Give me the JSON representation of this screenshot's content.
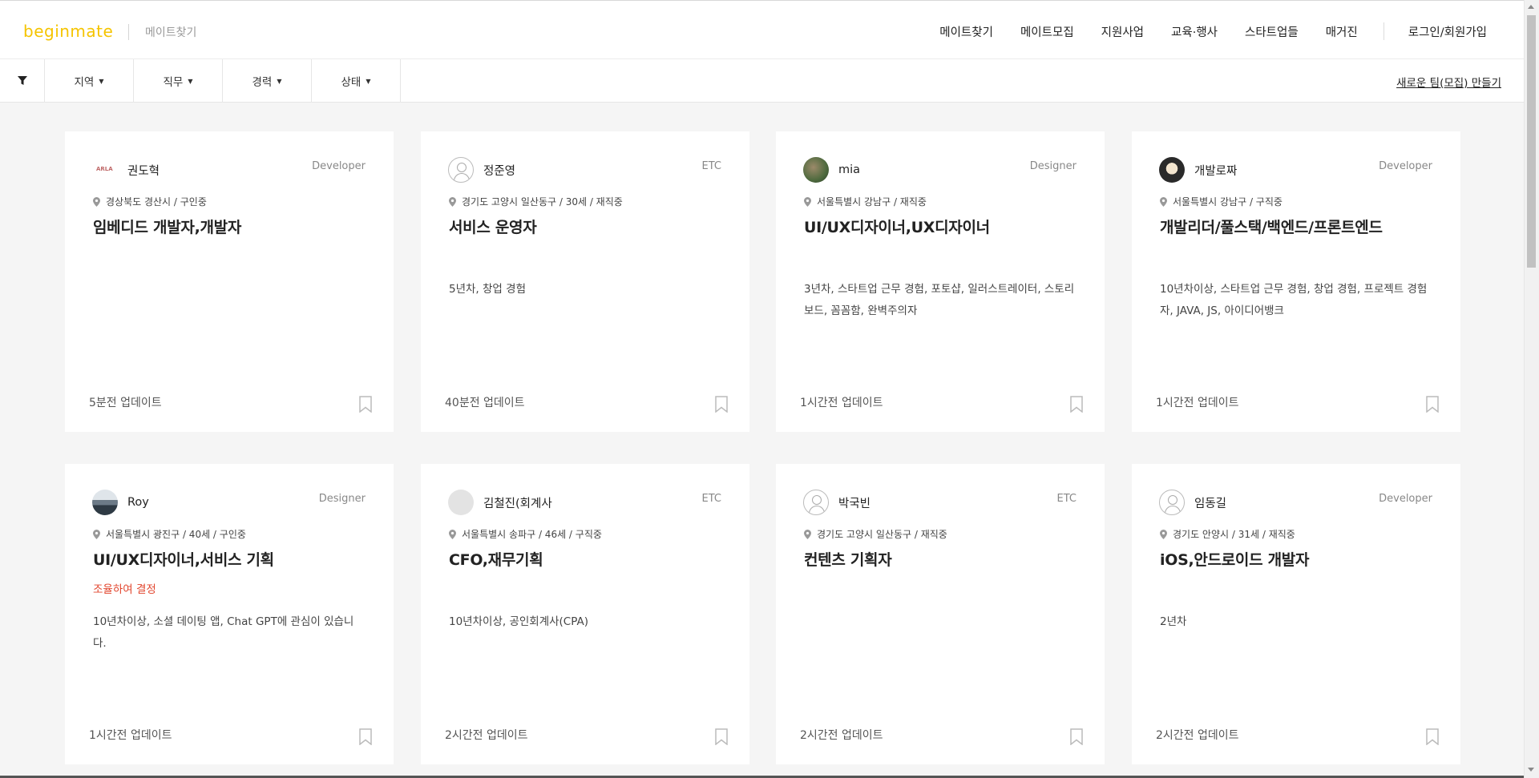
{
  "header": {
    "logo": "beginmate",
    "section": "메이트찾기",
    "nav": [
      "메이트찾기",
      "메이트모집",
      "지원사업",
      "교육·행사",
      "스타트업들",
      "매거진"
    ],
    "login": "로그인/회원가입"
  },
  "filters": {
    "icon": "filter-icon",
    "items": [
      "지역",
      "직무",
      "경력",
      "상태"
    ],
    "new_team": "새로운 팀(모집) 만들기"
  },
  "cards": [
    {
      "name": "권도혁",
      "role": "Developer",
      "avatar": "logo-tiny",
      "location": "경상북도 경산시 / 구인중",
      "title": "임베디드 개발자,개발자",
      "note": "",
      "desc": "",
      "updated": "5분전 업데이트"
    },
    {
      "name": "정준영",
      "role": "ETC",
      "avatar": "default",
      "location": "경기도 고양시 일산동구 / 30세 / 재직중",
      "title": "서비스 운영자",
      "note": "",
      "desc": "5년차, 창업 경험",
      "updated": "40분전 업데이트"
    },
    {
      "name": "mia",
      "role": "Designer",
      "avatar": "photo1",
      "location": "서울특별시 강남구 / 재직중",
      "title": "UI/UX디자이너,UX디자이너",
      "note": "",
      "desc": "3년차, 스타트업 근무 경험, 포토샵, 일러스트레이터, 스토리보드, 꼼꼼함, 완벽주의자",
      "updated": "1시간전 업데이트"
    },
    {
      "name": "개발로짜",
      "role": "Developer",
      "avatar": "photo2",
      "location": "서울특별시 강남구 / 구직중",
      "title": "개발리더/풀스택/백엔드/프론트엔드",
      "note": "",
      "desc": "10년차이상, 스타트업 근무 경험, 창업 경험, 프로젝트 경험자, JAVA, JS, 아이디어뱅크",
      "updated": "1시간전 업데이트"
    },
    {
      "name": "Roy",
      "role": "Designer",
      "avatar": "photo3",
      "location": "서울특별시 광진구 / 40세 / 구인중",
      "title": "UI/UX디자이너,서비스 기획",
      "note": "조율하여 결정",
      "desc": "10년차이상, 소셜 데이팅 앱, Chat GPT에 관심이 있습니다.",
      "updated": "1시간전 업데이트"
    },
    {
      "name": "김철진(회계사",
      "role": "ETC",
      "avatar": "blank",
      "location": "서울특별시 송파구 / 46세 / 구직중",
      "title": "CFO,재무기획",
      "note": "",
      "desc": "10년차이상, 공인회계사(CPA)",
      "updated": "2시간전 업데이트"
    },
    {
      "name": "박국빈",
      "role": "ETC",
      "avatar": "default",
      "location": "경기도 고양시 일산동구 / 재직중",
      "title": "컨텐츠 기획자",
      "note": "",
      "desc": "",
      "updated": "2시간전 업데이트"
    },
    {
      "name": "임동길",
      "role": "Developer",
      "avatar": "default",
      "location": "경기도 안양시 / 31세 / 재직중",
      "title": "iOS,안드로이드 개발자",
      "note": "",
      "desc": "2년차",
      "updated": "2시간전 업데이트"
    }
  ]
}
